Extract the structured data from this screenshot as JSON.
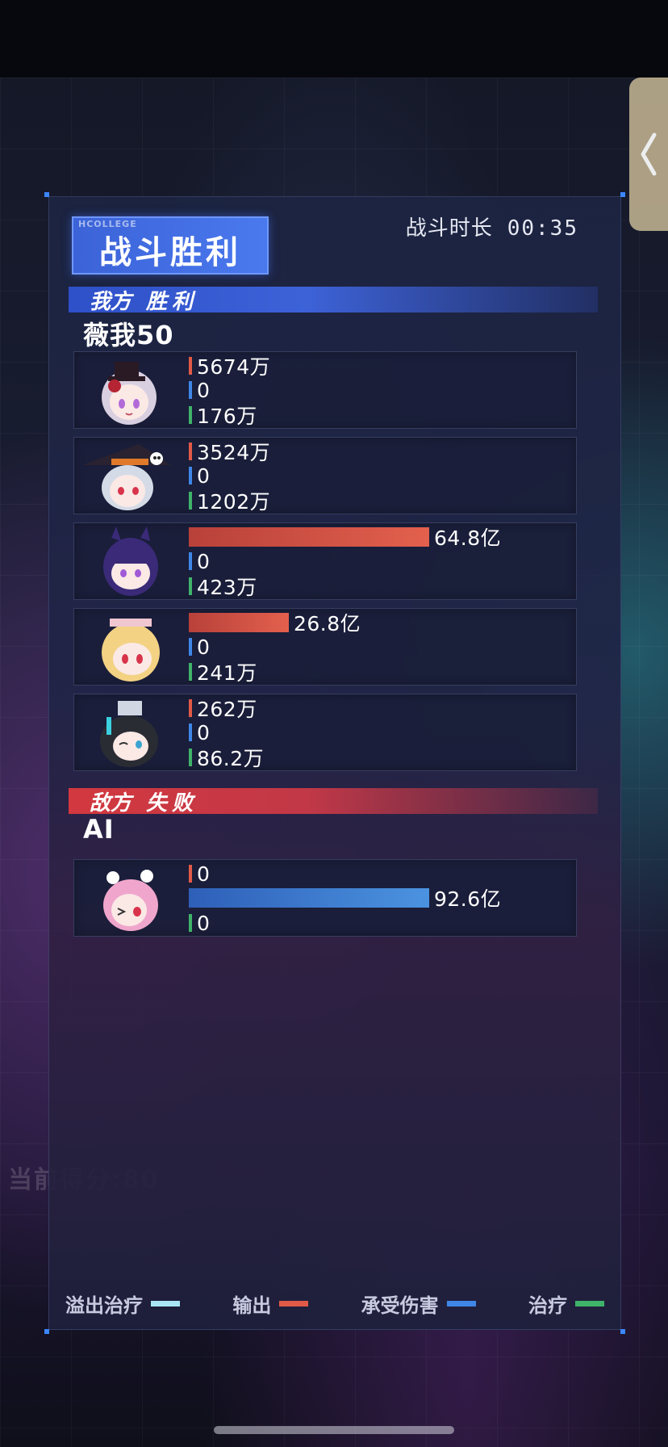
{
  "header": {
    "badge_sub": "HCOLLEGE",
    "badge_title": "战斗胜利",
    "duration_label": "战斗时长",
    "duration_value": "00:35"
  },
  "background_text": "当前得分:80",
  "ally": {
    "side_label": "我方",
    "result": "胜利",
    "team_name": "薇我50",
    "members": [
      {
        "name_icon": "chibi-top-hat-girl-avatar",
        "output": "5674万",
        "damage_taken": "0",
        "healing": "176万",
        "output_bar_fraction": 0
      },
      {
        "name_icon": "chibi-witch-hat-girl-avatar",
        "output": "3524万",
        "damage_taken": "0",
        "healing": "1202万",
        "output_bar_fraction": 0
      },
      {
        "name_icon": "chibi-purple-hair-girl-avatar",
        "output": "64.8亿",
        "damage_taken": "0",
        "healing": "423万",
        "output_bar_fraction": 1.0
      },
      {
        "name_icon": "chibi-blonde-girl-avatar",
        "output": "26.8亿",
        "damage_taken": "0",
        "healing": "241万",
        "output_bar_fraction": 0.414
      },
      {
        "name_icon": "chibi-black-hair-girl-avatar",
        "output": "262万",
        "damage_taken": "0",
        "healing": "86.2万",
        "output_bar_fraction": 0
      }
    ]
  },
  "enemy": {
    "side_label": "敌方",
    "result": "失败",
    "team_name": "AI",
    "members": [
      {
        "name_icon": "chibi-pink-hair-girl-avatar",
        "output": "0",
        "damage_taken": "92.6亿",
        "healing": "0",
        "damage_bar_fraction": 1.0
      }
    ]
  },
  "legend": {
    "overflow_heal": "溢出治疗",
    "output": "输出",
    "damage_taken": "承受伤害",
    "healing": "治疗"
  },
  "colors": {
    "output": "#e15a47",
    "damage_taken": "#3f86e6",
    "healing": "#3fb36a",
    "overflow_heal": "#a8e6f5",
    "ally_banner": "#2e50c8",
    "enemy_banner": "#d2383f"
  },
  "icons": {
    "side_tab": "chevron-left-icon"
  }
}
